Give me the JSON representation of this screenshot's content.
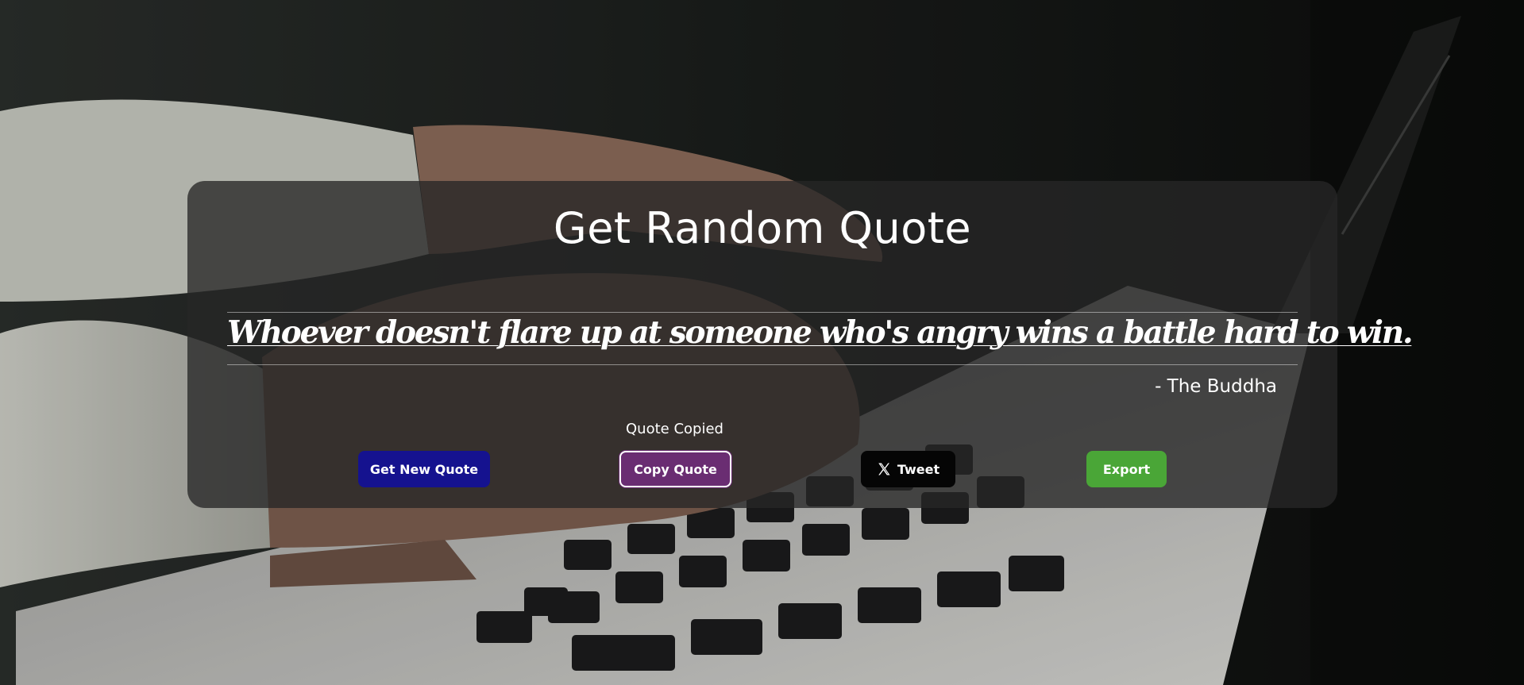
{
  "header": {
    "title": "Get Random Quote"
  },
  "quote": {
    "text": "Whoever doesn't flare up at someone who's angry wins a battle hard to win.",
    "author": "- The Buddha"
  },
  "status": {
    "toast": "Quote Copied"
  },
  "buttons": {
    "new_quote": "Get New Quote",
    "copy_quote": "Copy Quote",
    "tweet": "Tweet",
    "export": "Export"
  },
  "icons": {
    "tweet_icon": "x-logo-icon"
  },
  "colors": {
    "new_quote_button": "#15128f",
    "copy_quote_button": "#6a2d72",
    "tweet_button": "#050505",
    "export_button": "#4aa637",
    "card_background": "rgba(38,38,38,0.78)"
  }
}
